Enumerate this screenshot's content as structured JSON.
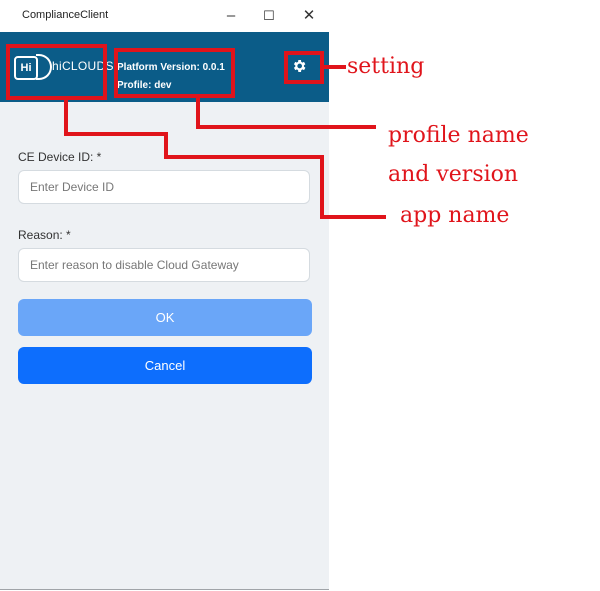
{
  "window": {
    "title": "ComplianceClient",
    "minimize_glyph": "–",
    "maximize_glyph": "☐",
    "close_glyph": "✕"
  },
  "header": {
    "logo_badge": "Hi",
    "logo_text": "hiCLOUDS",
    "platform_version": "Platform Version: 0.0.1",
    "profile": "Profile: dev",
    "settings_icon": "gear-icon"
  },
  "form": {
    "device_id_label": "CE Device ID: *",
    "device_id_placeholder": "Enter Device ID",
    "reason_label": "Reason: *",
    "reason_placeholder": "Enter reason to disable Cloud Gateway",
    "ok_label": "OK",
    "cancel_label": "Cancel"
  },
  "annotations": {
    "setting": "setting",
    "profile_name": "profile name",
    "and_version": "and version",
    "app_name": "app name"
  },
  "colors": {
    "header_bg": "#0b5c88",
    "annotation": "#e0141b",
    "ok_button": "#6aa6f8",
    "cancel_button": "#0d6efd"
  }
}
